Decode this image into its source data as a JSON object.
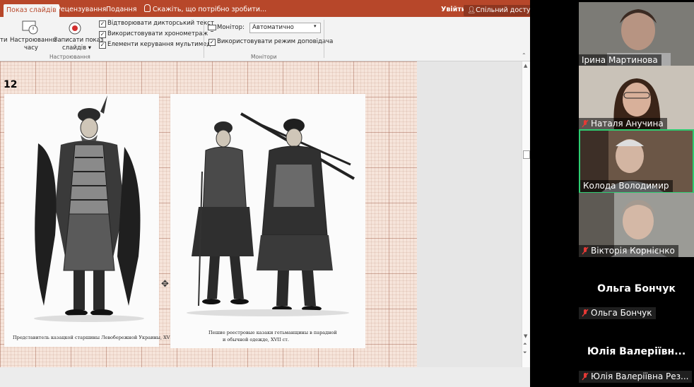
{
  "powerpoint": {
    "tabs": [
      {
        "label": "Показ слайдів",
        "active": true
      },
      {
        "label": "Рецензування",
        "active": false
      },
      {
        "label": "Подання",
        "active": false
      }
    ],
    "search_placeholder": "Скажіть, що потрібно зробити...",
    "sign_in": "Увійти",
    "share": "Спільний доступ",
    "ribbon": {
      "ti_fragment": "ти",
      "rehearse_line1": "Настроювання",
      "rehearse_line2": "часу",
      "record_line1": "Записати показ",
      "record_line2": "слайдів ▾",
      "checkbox_narration": "Відтворювати дикторський текст",
      "checkbox_timings": "Використовувати хронометраж",
      "checkbox_media": "Елементи керування мультимедіа",
      "group_setup": "Настроювання",
      "monitor_label": "Монітор:",
      "monitor_value": "Автоматично",
      "presenter_view": "Використовувати режим доповідача",
      "group_monitors": "Монітори"
    },
    "slide": {
      "number": "12",
      "caption_left": "Представитель казацкой старшины Левобережной Украины, XVII ст.",
      "caption_right_line1": "Пешие реестровые казаки гетьманщины в парадной",
      "caption_right_line2": "и обычной одежде, XVII ст."
    }
  },
  "zoom": {
    "participants": [
      {
        "name": "Ірина Мартинова",
        "muted": false
      },
      {
        "name": "Наталя Анучина",
        "muted": true
      },
      {
        "name": "Колода Володимир",
        "muted": false,
        "active_speaker": true
      },
      {
        "name": "Вікторія Корнієнко",
        "muted": true
      },
      {
        "name": "Ольга Бончук",
        "muted": true,
        "video": false,
        "display_name": "Ольга Бончук"
      },
      {
        "name": "Юлія Валеріївна Рез...",
        "muted": true,
        "video": false,
        "display_name": "Юлія Валеріївн..."
      }
    ],
    "colors": {
      "active_border": "#2ecc71",
      "muted_icon": "#e53935",
      "ppt_accent": "#b7472a"
    }
  }
}
